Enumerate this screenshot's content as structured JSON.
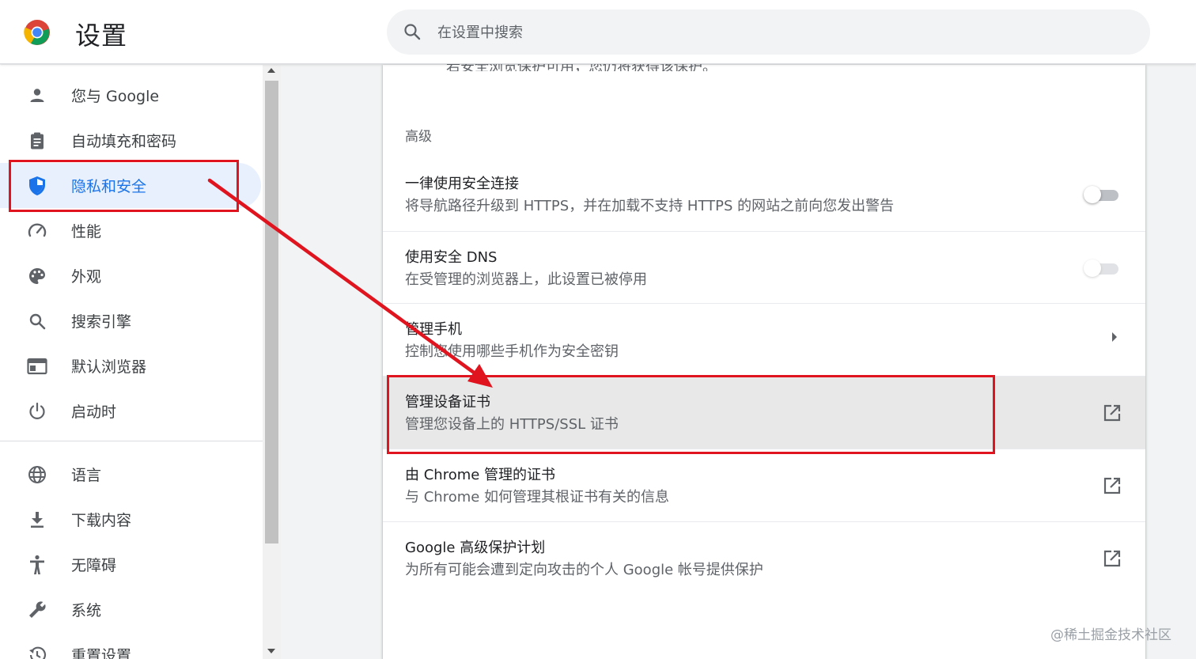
{
  "header": {
    "title": "设置",
    "search_placeholder": "在设置中搜索",
    "search_icon": "search-icon",
    "logo_icon": "chrome-logo"
  },
  "sidebar": {
    "items": [
      {
        "label": "您与 Google",
        "icon": "person-icon"
      },
      {
        "label": "自动填充和密码",
        "icon": "clipboard-icon"
      },
      {
        "label": "隐私和安全",
        "icon": "shield-icon",
        "active": true
      },
      {
        "label": "性能",
        "icon": "speedometer-icon"
      },
      {
        "label": "外观",
        "icon": "palette-icon"
      },
      {
        "label": "搜索引擎",
        "icon": "search-icon"
      },
      {
        "label": "默认浏览器",
        "icon": "browser-icon"
      },
      {
        "label": "启动时",
        "icon": "power-icon"
      },
      {
        "label": "语言",
        "icon": "globe-icon"
      },
      {
        "label": "下载内容",
        "icon": "download-icon"
      },
      {
        "label": "无障碍",
        "icon": "accessibility-icon"
      },
      {
        "label": "系统",
        "icon": "wrench-icon"
      },
      {
        "label": "重置设置",
        "icon": "history-icon"
      }
    ],
    "active_color": "#1a73e8"
  },
  "main": {
    "clipped_text": "若安全浏览保护可用，您仍将获得该保护。",
    "section_title": "高级",
    "rows": [
      {
        "title": "一律使用安全连接",
        "sub": "将导航路径升级到 HTTPS，并在加载不支持 HTTPS 的网站之前向您发出警告",
        "control": "toggle",
        "state": "off"
      },
      {
        "title": "使用安全 DNS",
        "sub": "在受管理的浏览器上，此设置已被停用",
        "control": "toggle",
        "state": "disabled"
      },
      {
        "title": "管理手机",
        "sub": "控制您使用哪些手机作为安全密钥",
        "control": "chevron-right-icon"
      },
      {
        "title": "管理设备证书",
        "sub": "管理您设备上的 HTTPS/SSL 证书",
        "control": "open-in-new-icon",
        "highlighted": true
      },
      {
        "title": "由 Chrome 管理的证书",
        "sub": "与 Chrome 如何管理其根证书有关的信息",
        "control": "open-in-new-icon"
      },
      {
        "title": "Google 高级保护计划",
        "sub": "为所有可能会遭到定向攻击的个人 Google 帐号提供保护",
        "control": "open-in-new-icon"
      }
    ]
  },
  "annotation": {
    "color": "#e0141e"
  },
  "watermark": "@稀土掘金技术社区"
}
